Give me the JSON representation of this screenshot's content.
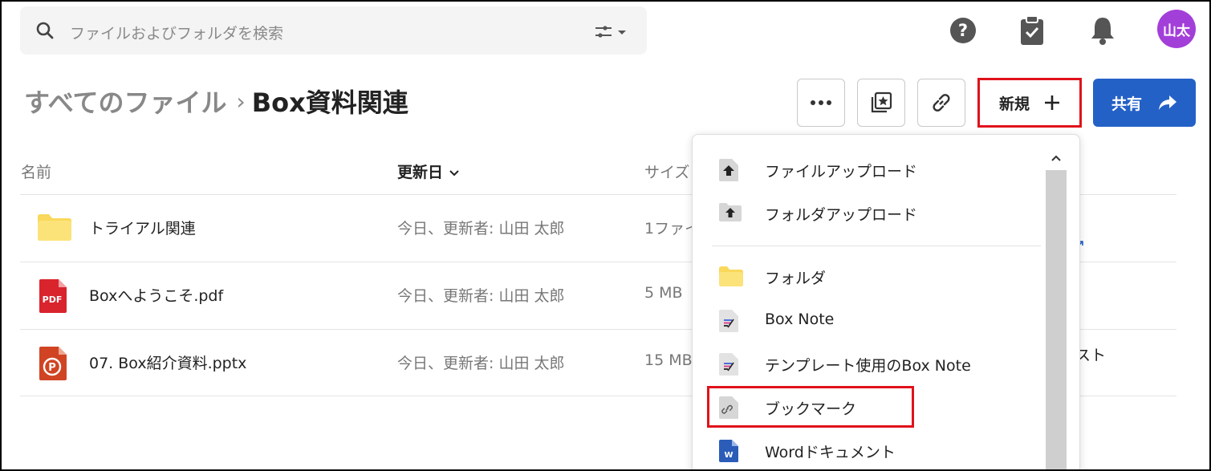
{
  "search": {
    "placeholder": "ファイルおよびフォルダを検索"
  },
  "user": {
    "avatar_initials": "山太",
    "avatar_color": "#a33fd9"
  },
  "breadcrumb": {
    "root": "すべてのファイル",
    "current": "Box資料関連"
  },
  "toolbar": {
    "new_label": "新規",
    "share_label": "共有"
  },
  "table": {
    "headers": {
      "name": "名前",
      "modified": "更新日",
      "size": "サイズ"
    },
    "rows": [
      {
        "icon": "folder-icon",
        "name": "トライアル関連",
        "modified": "今日、更新者: 山田 太郎",
        "size": "1ファイ"
      },
      {
        "icon": "pdf-icon",
        "name": "Boxへようこそ.pdf",
        "modified": "今日、更新者: 山田 太郎",
        "size": "5 MB"
      },
      {
        "icon": "pptx-icon",
        "name": "07. Box紹介資料.pptx",
        "modified": "今日、更新者: 山田 太郎",
        "size": "15 MB"
      }
    ],
    "right_peek_text": "スト"
  },
  "new_menu": {
    "items": [
      {
        "icon": "file-upload-icon",
        "label": "ファイルアップロード"
      },
      {
        "icon": "folder-upload-icon",
        "label": "フォルダアップロード"
      },
      {
        "icon": "folder-icon",
        "label": "フォルダ"
      },
      {
        "icon": "box-note-icon",
        "label": "Box Note"
      },
      {
        "icon": "box-note-template-icon",
        "label": "テンプレート使用のBox Note"
      },
      {
        "icon": "bookmark-icon",
        "label": "ブックマーク"
      },
      {
        "icon": "word-icon",
        "label": "Wordドキュメント"
      }
    ]
  },
  "colors": {
    "accent": "#2461c7",
    "highlight": "#e0121b",
    "folder": "#f9d85b",
    "pdf": "#d9232d",
    "pptx": "#d04423",
    "word": "#2b5cb8"
  }
}
